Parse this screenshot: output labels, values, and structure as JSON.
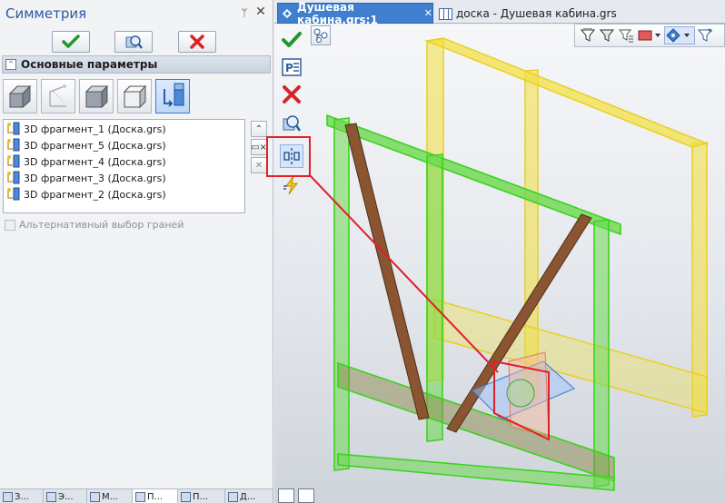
{
  "panel": {
    "title": "Симметрия",
    "pin_glyph": "ᛘ",
    "close_glyph": "✕",
    "actions": {
      "ok_icon": "checkmark-icon",
      "preview_icon": "preview-icon",
      "cancel_icon": "x-icon"
    },
    "section": {
      "title": "Основные параметры",
      "collapse_glyph": "⌃"
    },
    "modes": [
      {
        "icon": "face-icon"
      },
      {
        "icon": "edge-icon"
      },
      {
        "icon": "box-icon"
      },
      {
        "icon": "box-outline-icon"
      },
      {
        "icon": "fragment-icon",
        "active": true
      }
    ],
    "objects": [
      {
        "label": "3D фрагмент_1 (Доска.grs)"
      },
      {
        "label": "3D фрагмент_5 (Доска.grs)"
      },
      {
        "label": "3D фрагмент_4 (Доска.grs)"
      },
      {
        "label": "3D фрагмент_3 (Доска.grs)"
      },
      {
        "label": "3D фрагмент_2 (Доска.grs)"
      }
    ],
    "side_buttons": {
      "up_glyph": "⌃",
      "remove_glyph": "▭×",
      "clear_glyph": "✕"
    },
    "alt_selection": {
      "label": "Альтернативный выбор граней",
      "checked": false,
      "enabled": false
    },
    "bottom_tabs": [
      {
        "label": "З..."
      },
      {
        "label": "Э..."
      },
      {
        "label": "М..."
      },
      {
        "label": "П...",
        "active": true
      },
      {
        "label": "П..."
      },
      {
        "label": "Д..."
      }
    ]
  },
  "document_tabs": [
    {
      "label": "Душевая кабина.grs:1",
      "close_glyph": "✕",
      "active": true
    },
    {
      "label": "доска - Душевая кабина.grs",
      "active": false
    }
  ],
  "colors": {
    "accent": "#3f7fd0",
    "selected_green": "#3fdc2c",
    "yellow_frame": "#f2df3c",
    "wood": "#8a5530",
    "highlight_red": "#e0202a"
  }
}
